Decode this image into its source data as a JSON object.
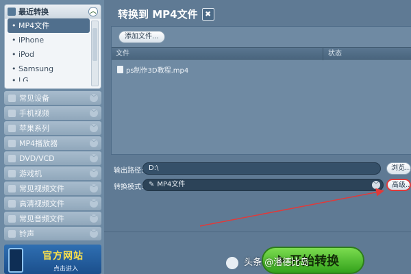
{
  "sidebar": {
    "recent_header": "最近转换",
    "recent_items": [
      "MP4文件",
      "iPhone",
      "iPod",
      "Samsung",
      "LG"
    ],
    "categories": [
      {
        "label": "常见设备",
        "icon": "device-icon"
      },
      {
        "label": "手机视频",
        "icon": "phone-icon"
      },
      {
        "label": "苹果系列",
        "icon": "apple-icon"
      },
      {
        "label": "MP4播放器",
        "icon": "mp4-player-icon"
      },
      {
        "label": "DVD/VCD",
        "icon": "disc-icon"
      },
      {
        "label": "游戏机",
        "icon": "gamepad-icon"
      },
      {
        "label": "常见视频文件",
        "icon": "video-file-icon"
      },
      {
        "label": "高清视频文件",
        "icon": "hd-video-icon"
      },
      {
        "label": "常见音频文件",
        "icon": "music-icon"
      },
      {
        "label": "铃声",
        "icon": "bell-icon"
      }
    ],
    "banner": {
      "title": "官方网站",
      "subtitle": "点击进入"
    }
  },
  "main": {
    "title": "转换到 MP4文件",
    "add_file_label": "添加文件...",
    "table": {
      "columns": [
        "文件",
        "状态"
      ],
      "rows": [
        {
          "name": "ps制作3D教程.mp4",
          "status": ""
        }
      ]
    },
    "output_path_label": "输出路径:",
    "output_path_value": "D:\\",
    "browse_label": "浏览...",
    "mode_label": "转换模式:",
    "mode_value": "MP4文件",
    "advanced_label": "高级...",
    "start_label": "开始转换"
  },
  "watermark": {
    "text": "头条 @潘德比岛"
  },
  "colors": {
    "accent_green": "#34a21c",
    "highlight_red": "#e03a3a",
    "panel_blue": "#6f8aa3"
  }
}
